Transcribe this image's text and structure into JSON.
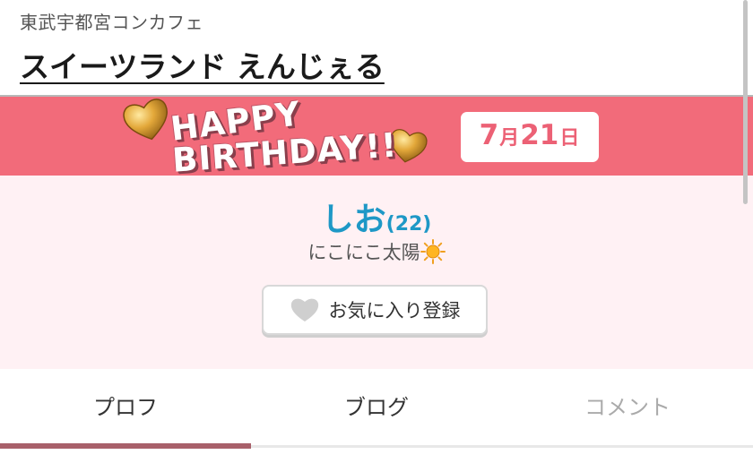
{
  "header": {
    "area": "東武宇都宮コンカフェ",
    "shop_name": "スイーツランド えんじぇる"
  },
  "banner": {
    "line1": "HAPPY",
    "line2": "BIRTHDAY!!",
    "date_month": "7",
    "date_month_unit": "月",
    "date_day": "21",
    "date_day_unit": "日",
    "bg_color": "#f26b7a"
  },
  "profile": {
    "name": "しお",
    "age": "(22)",
    "catchphrase": "にこにこ太陽",
    "name_color": "#1e98c6",
    "favorite_label": "お気に入り登録"
  },
  "tabs": [
    {
      "label": "プロフ",
      "active": true
    },
    {
      "label": "ブログ",
      "active": false
    },
    {
      "label": "コメント",
      "active": false
    }
  ],
  "icons": {
    "favorite": "heart-icon",
    "sun": "sun-icon",
    "decor": "gold-heart-icon"
  }
}
